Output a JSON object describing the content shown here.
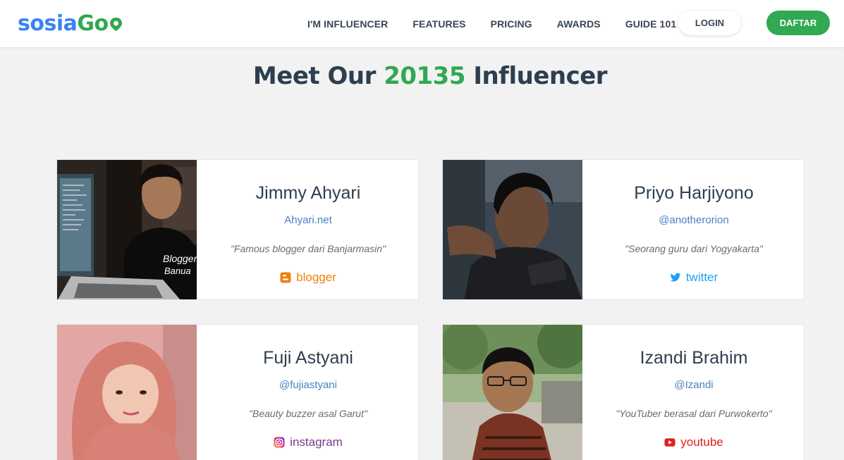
{
  "nav": {
    "logo_part1": "sosia",
    "logo_part2": "Go",
    "links": [
      "I'M INFLUENCER",
      "FEATURES",
      "PRICING",
      "AWARDS",
      "GUIDE 101"
    ],
    "login_label": "LOGIN",
    "signup_label": "DAFTAR"
  },
  "headline": {
    "prefix": "Meet Our ",
    "count": "20135",
    "suffix": " Influencer"
  },
  "influencers": [
    {
      "name": "Jimmy Ahyari",
      "handle": "Ahyari.net",
      "quote": "\"Famous blogger dari Banjarmasin\"",
      "platform": "blogger",
      "platform_icon": "blogger-icon"
    },
    {
      "name": "Priyo Harjiyono",
      "handle": "@anotherorion",
      "quote": "\"Seorang guru dari Yogyakarta\"",
      "platform": "twitter",
      "platform_icon": "twitter-icon"
    },
    {
      "name": "Fuji Astyani",
      "handle": "@fujiastyani",
      "quote": "\"Beauty buzzer asal Garut\"",
      "platform": "instagram",
      "platform_icon": "instagram-icon"
    },
    {
      "name": "Izandi Brahim",
      "handle": "@Izandi",
      "quote": "\"YouTuber berasal dari Purwokerto\"",
      "platform": "youtube",
      "platform_icon": "youtube-icon"
    }
  ],
  "colors": {
    "brand_blue": "#3b82f6",
    "brand_green": "#31a852",
    "text_dark": "#2d3e50",
    "blogger": "#f0800f",
    "twitter": "#1da1f2",
    "instagram": "#7a3a8c",
    "youtube": "#e02020"
  }
}
